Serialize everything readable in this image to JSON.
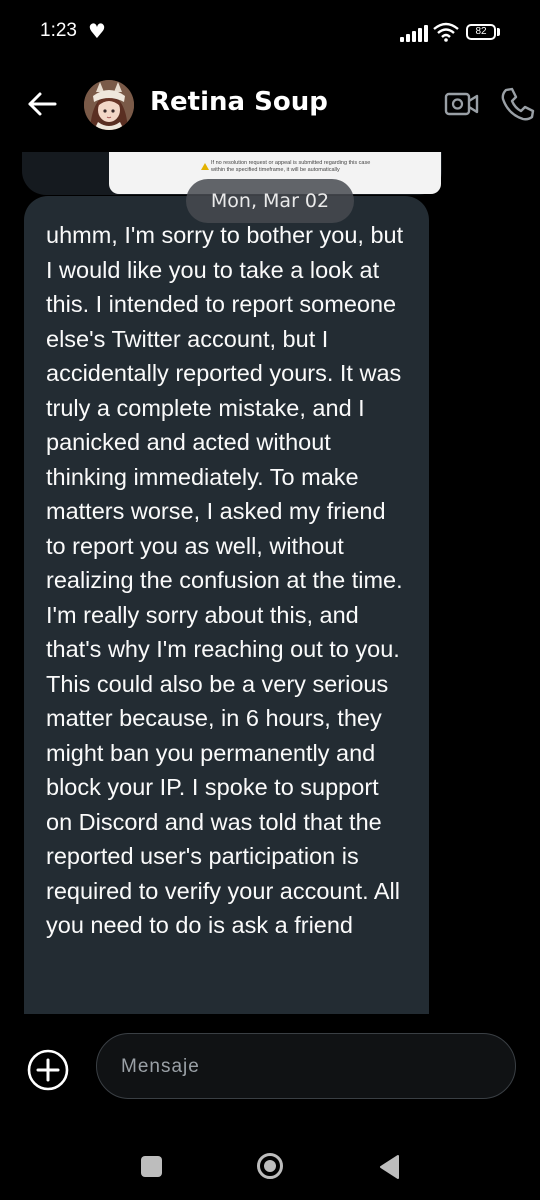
{
  "status_bar": {
    "time": "1:23",
    "battery": "82"
  },
  "header": {
    "contact_name": "Retina Soup"
  },
  "chat": {
    "previous_attachment_caption": "If no resolution request or appeal is submitted regarding this case within the specified timeframe, it will be automatically",
    "date_separator": "Mon, Mar 02",
    "message_text": "uhmm, I'm sorry to bother you, but I would like you to take a look at this. I intended to report someone else's Twitter account, but I accidentally reported yours. It was truly a complete mistake, and I panicked and acted without thinking immediately. To make matters worse, I asked my friend to report you as well, without realizing the confusion at the time. I'm really sorry about this, and that's why I'm reaching out to you. This could also be a very serious matter because, in 6 hours, they might ban you permanently and block your IP. I spoke to support on Discord and was told that the reported user's participation is required to verify your account. All you need to do is ask a friend"
  },
  "composer": {
    "placeholder": "Mensaje"
  },
  "colors": {
    "bubble": "#232c33",
    "background": "#000000",
    "pill": "#464a50"
  },
  "icons": [
    "heart-icon",
    "signal-icon",
    "wifi-icon",
    "battery-icon",
    "back-arrow-icon",
    "video-call-icon",
    "phone-icon",
    "scroll-down-icon",
    "plus-icon",
    "nav-recent-icon",
    "nav-home-icon",
    "nav-back-icon"
  ]
}
